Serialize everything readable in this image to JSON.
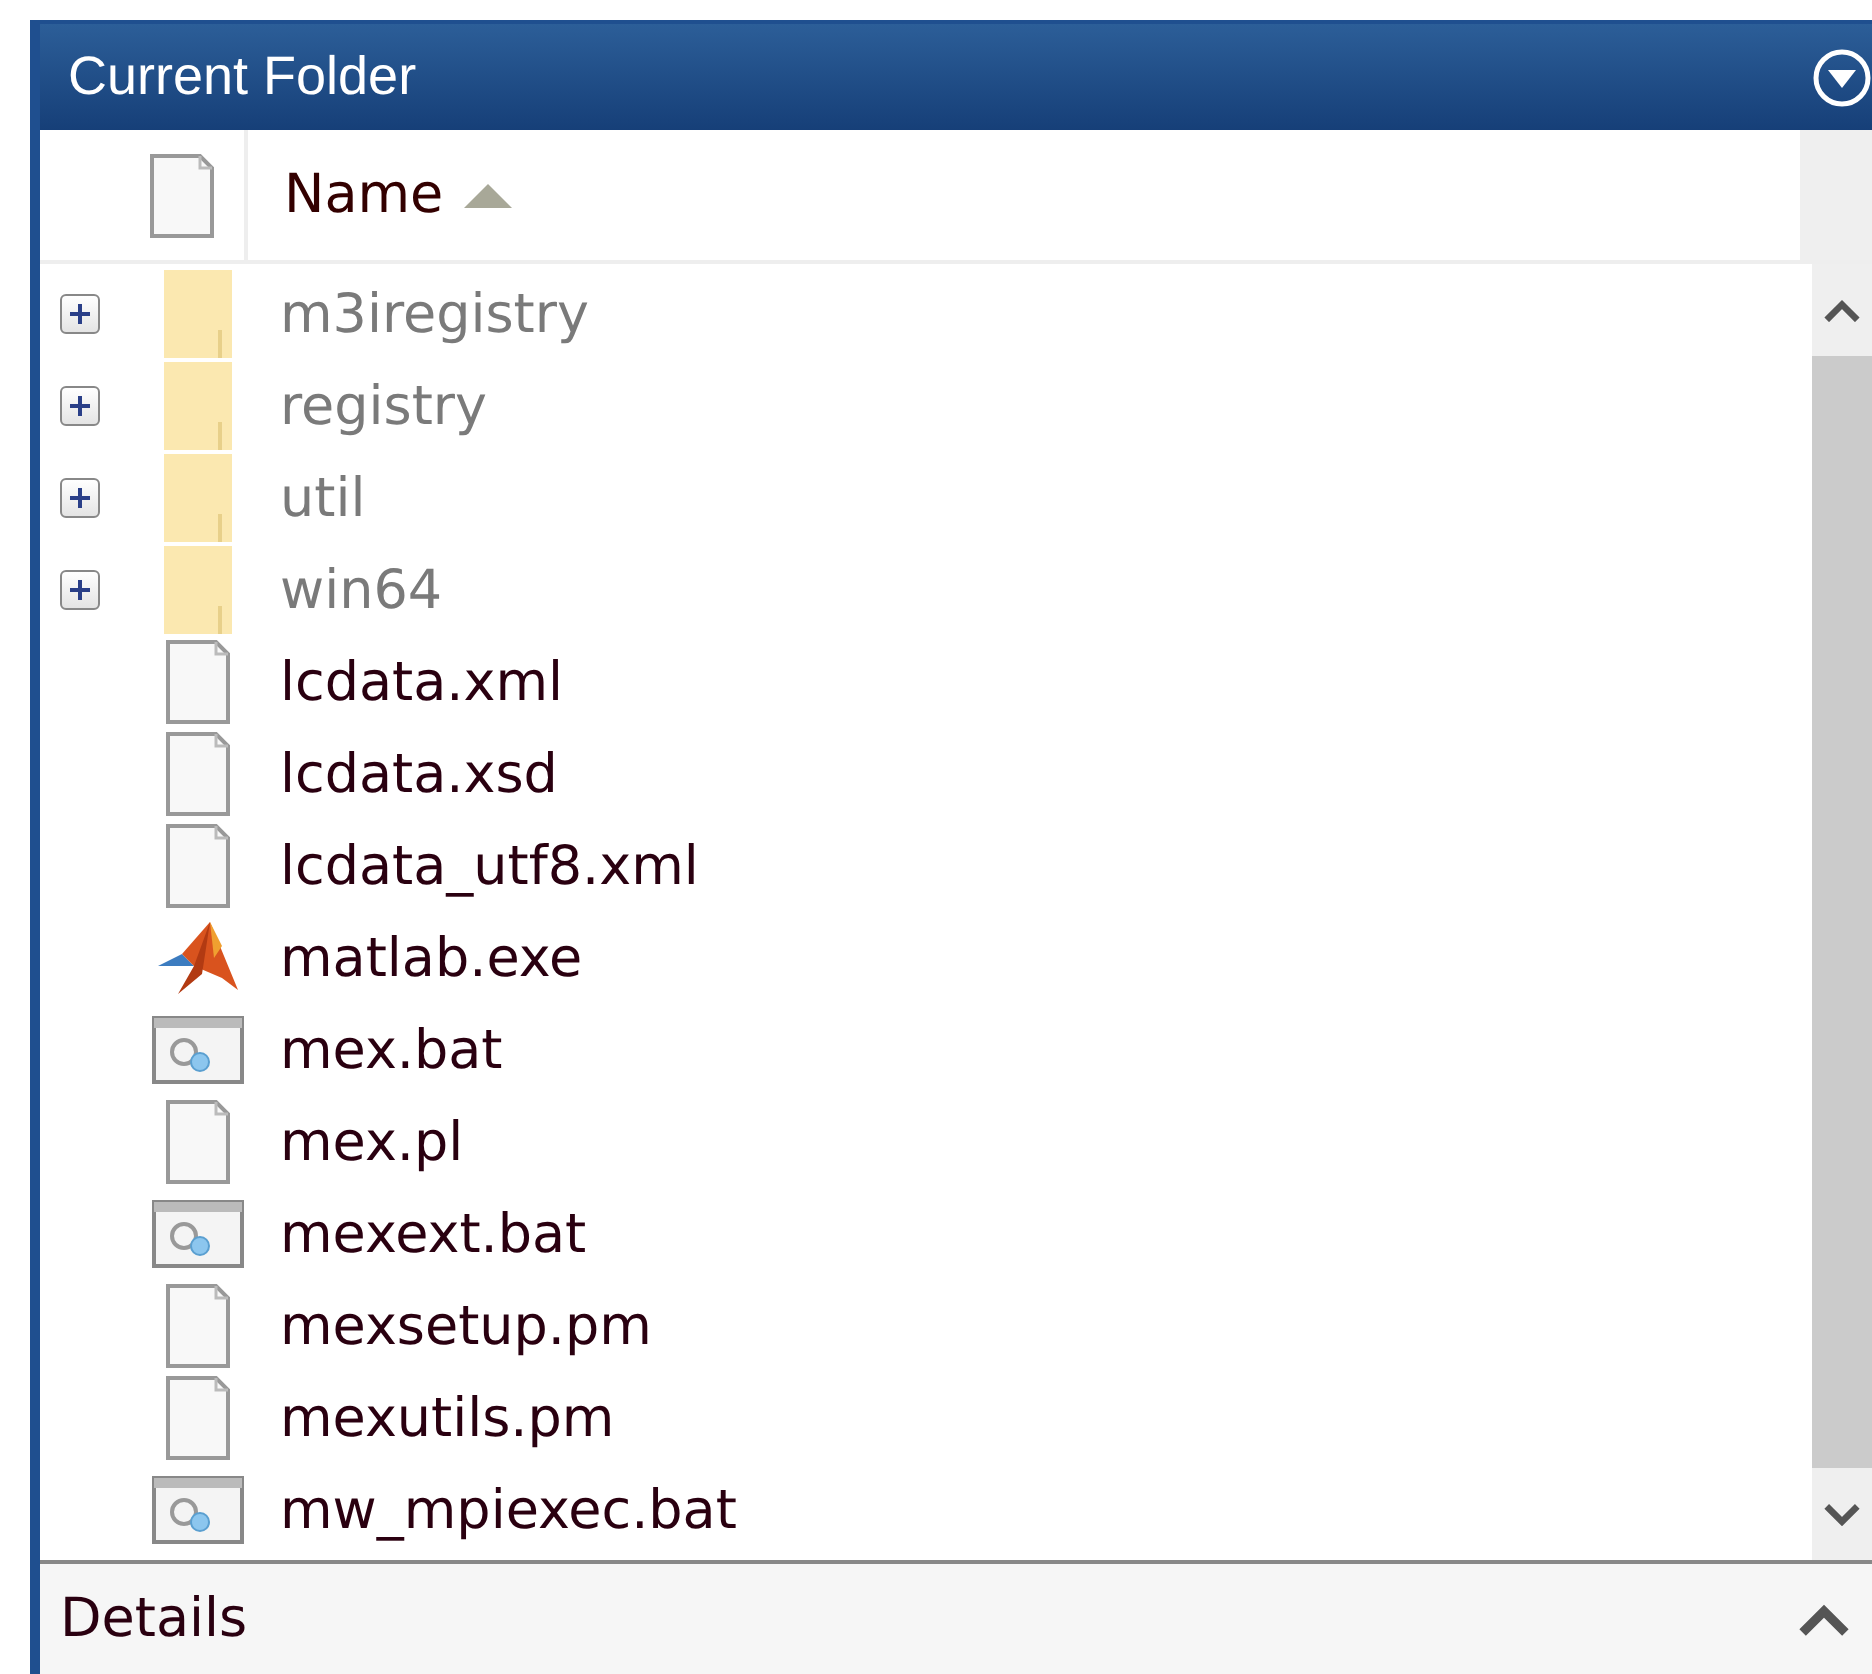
{
  "panel": {
    "title": "Current Folder"
  },
  "columns": [
    {
      "label": "Name",
      "sort_ascending": true
    }
  ],
  "rows": [
    {
      "name": "m3iregistry",
      "kind": "folder",
      "expanded": false
    },
    {
      "name": "registry",
      "kind": "folder",
      "expanded": false
    },
    {
      "name": "util",
      "kind": "folder",
      "expanded": false
    },
    {
      "name": "win64",
      "kind": "folder",
      "expanded": false
    },
    {
      "name": "lcdata.xml",
      "kind": "file"
    },
    {
      "name": "lcdata.xsd",
      "kind": "file"
    },
    {
      "name": "lcdata_utf8.xml",
      "kind": "file"
    },
    {
      "name": "matlab.exe",
      "kind": "app"
    },
    {
      "name": "mex.bat",
      "kind": "script"
    },
    {
      "name": "mex.pl",
      "kind": "file"
    },
    {
      "name": "mexext.bat",
      "kind": "script"
    },
    {
      "name": "mexsetup.pm",
      "kind": "file"
    },
    {
      "name": "mexutils.pm",
      "kind": "file"
    },
    {
      "name": "mw_mpiexec.bat",
      "kind": "script"
    }
  ],
  "details": {
    "label": "Details",
    "expanded": false
  }
}
